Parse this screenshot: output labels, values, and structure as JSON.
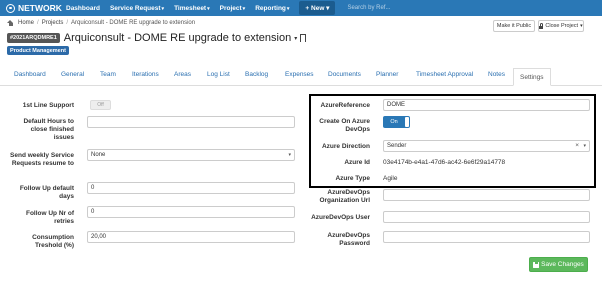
{
  "navbar": {
    "brand": "NETWORK",
    "items": [
      {
        "label": "Dashboard",
        "caret": ""
      },
      {
        "label": "Service Request",
        "caret": "▾"
      },
      {
        "label": "Timesheet",
        "caret": "▾"
      },
      {
        "label": "Project",
        "caret": "▾"
      },
      {
        "label": "Reporting",
        "caret": "▾"
      }
    ],
    "new_button": "+ New ▾",
    "search_placeholder": "Search by Ref..."
  },
  "breadcrumb": {
    "home": "Home",
    "projects": "Projects",
    "current": "Arquiconsult - DOME RE upgrade to extension"
  },
  "header": {
    "project_id": "#2021ARQDMRE1",
    "title": "Arquiconsult - DOME RE upgrade to extension",
    "title_caret": "▾",
    "category_badge": "Product Management",
    "make_public_label": "Make it Public",
    "close_project_label": "Close Project",
    "close_caret": "▾"
  },
  "tabs": [
    "Dashboard",
    "General",
    "Team",
    "Iterations",
    "Areas",
    "Log List",
    "Backlog",
    "Expenses",
    "Documents",
    "Planner",
    "Timesheet Approval",
    "Notes",
    "Settings"
  ],
  "active_tab": "Settings",
  "form_left": {
    "first_line_support_label": "1st Line Support",
    "first_line_support_value": "Off",
    "default_hours_label": "Default Hours to close finished issues",
    "default_hours_value": "",
    "weekly_sr_label": "Send weekly Service Requests resume to",
    "weekly_sr_value": "None",
    "followup_days_label": "Follow Up default days",
    "followup_days_value": "0",
    "followup_retries_label": "Follow Up Nr of retries",
    "followup_retries_value": "0",
    "consumption_label": "Consumption Treshold (%)",
    "consumption_value": "20,00"
  },
  "form_right": {
    "azure_reference_label": "AzureReference",
    "azure_reference_value": "DOME",
    "create_on_azure_label": "Create On Azure DevOps",
    "create_on_azure_value": "On",
    "azure_direction_label": "Azure Direction",
    "azure_direction_value": "Sender",
    "azure_id_label": "Azure Id",
    "azure_id_value": "03e4174b-e4a1-47d6-ac42-6e6f29a14778",
    "azure_type_label": "Azure Type",
    "azure_type_value": "Agile",
    "org_url_label": "AzureDevOps Organization Url",
    "org_url_value": "",
    "user_label": "AzureDevOps User",
    "user_value": "",
    "password_label": "AzureDevOps Password",
    "password_value": ""
  },
  "save_label": "Save Changes",
  "colors": {
    "navbar": "#2a78b6",
    "badge_blue": "#2c6aa8",
    "save_green": "#5cb85c",
    "toggle_on": "#2a78b6"
  }
}
